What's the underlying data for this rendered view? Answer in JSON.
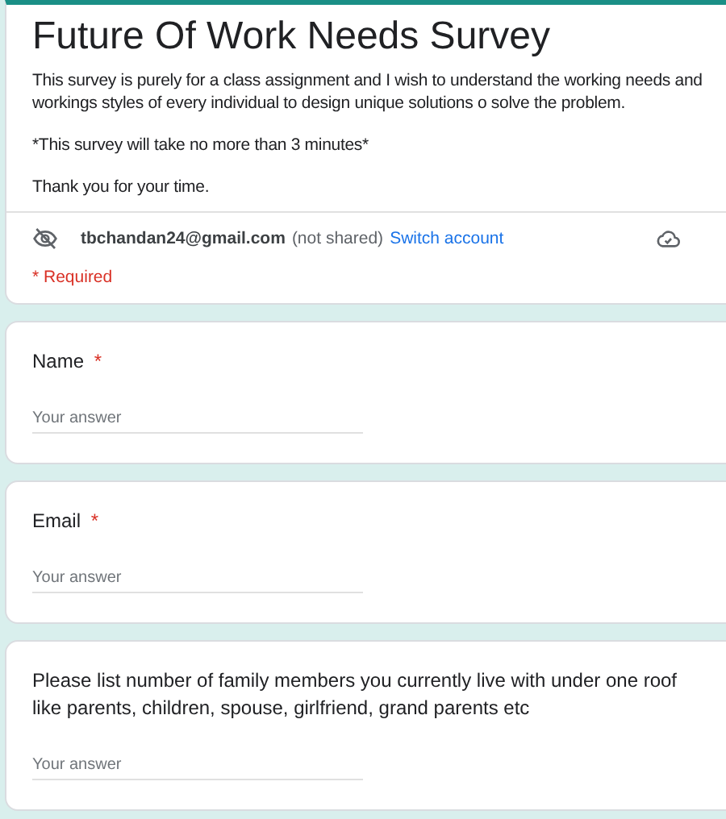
{
  "form": {
    "title": "Future Of Work Needs Survey",
    "description": [
      "This survey is purely for a class assignment and I wish to understand the working needs and workings styles of every individual to design unique solutions o solve the problem.",
      "*This survey will take no more than 3 minutes*",
      "Thank you for your time."
    ],
    "account": {
      "email": "tbchandan24@gmail.com",
      "note": "(not shared)",
      "switch_link": "Switch account"
    },
    "required_note": "* Required",
    "required_mark": "*"
  },
  "questions": [
    {
      "label": "Name",
      "required": true,
      "placeholder": "Your answer"
    },
    {
      "label": "Email",
      "required": true,
      "placeholder": "Your answer"
    },
    {
      "label": "Please list number of family members you currently live with under one roof like parents, children, spouse, girlfriend, grand parents etc",
      "required": false,
      "placeholder": "Your answer"
    }
  ]
}
